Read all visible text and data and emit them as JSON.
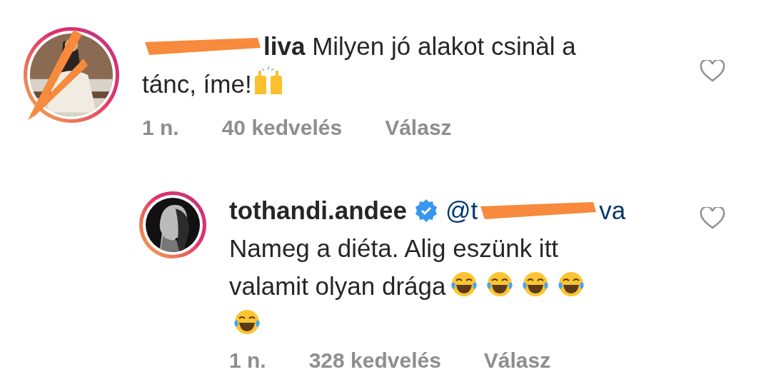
{
  "comments": [
    {
      "kind": "comment",
      "avatar": {
        "kind": "picture",
        "redacted": true
      },
      "username_visible": "liva",
      "username_redacted": true,
      "verified": false,
      "text_lines": [
        "Milyen jó alakot csinàl a",
        "tánc, íme!"
      ],
      "emojis": [
        {
          "kind": "raised-hands"
        }
      ],
      "time": "1 n.",
      "likes": "40 kedvelés",
      "reply": "Válasz",
      "liked": false
    },
    {
      "kind": "reply",
      "avatar": {
        "kind": "picture",
        "redacted": false
      },
      "username_visible": "tothandi.andee",
      "username_redacted": false,
      "verified": true,
      "mention": {
        "start": "@t",
        "end": "va",
        "redacted": true
      },
      "text_lines": [
        "Nameg a diéta. Alig eszünk itt",
        "valamit olyan drága"
      ],
      "emojis": [
        {
          "kind": "laugh"
        },
        {
          "kind": "laugh"
        },
        {
          "kind": "laugh"
        },
        {
          "kind": "laugh"
        },
        {
          "kind": "laugh"
        }
      ],
      "time": "1 n.",
      "likes": "328 kedvelés",
      "reply": "Válasz",
      "liked": false
    }
  ]
}
